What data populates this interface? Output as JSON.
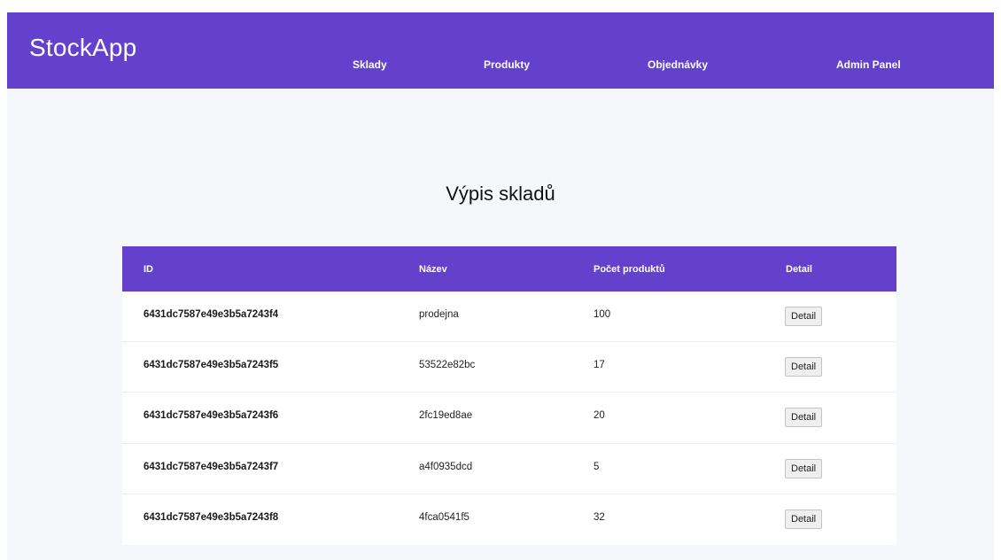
{
  "header": {
    "brand": "StockApp",
    "nav": [
      "Sklady",
      "Produkty",
      "Objednávky",
      "Admin Panel"
    ]
  },
  "page": {
    "title": "Výpis skladů"
  },
  "table": {
    "columns": [
      "ID",
      "Název",
      "Počet produktů",
      "Detail"
    ],
    "rows": [
      {
        "id": "6431dc7587e49e3b5a7243f4",
        "name": "prodejna",
        "count": "100",
        "action": "Detail"
      },
      {
        "id": "6431dc7587e49e3b5a7243f5",
        "name": "53522e82bc",
        "count": "17",
        "action": "Detail"
      },
      {
        "id": "6431dc7587e49e3b5a7243f6",
        "name": "2fc19ed8ae",
        "count": "20",
        "action": "Detail"
      },
      {
        "id": "6431dc7587e49e3b5a7243f7",
        "name": "a4f0935dcd",
        "count": "5",
        "action": "Detail"
      },
      {
        "id": "6431dc7587e49e3b5a7243f8",
        "name": "4fca0541f5",
        "count": "32",
        "action": "Detail"
      }
    ]
  },
  "colors": {
    "accent": "#6441cc",
    "background": "#f6f7fb"
  }
}
